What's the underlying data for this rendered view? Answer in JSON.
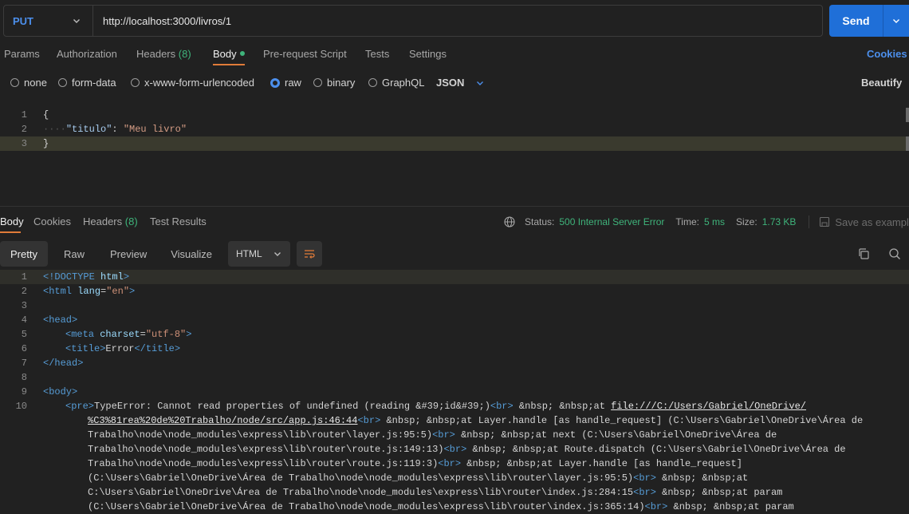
{
  "request": {
    "method": "PUT",
    "url": "http://localhost:3000/livros/1",
    "send_label": "Send"
  },
  "req_tabs": {
    "params": "Params",
    "authorization": "Authorization",
    "headers": "Headers",
    "headers_count": "(8)",
    "body": "Body",
    "prerequest": "Pre-request Script",
    "tests": "Tests",
    "settings": "Settings",
    "cookies": "Cookies"
  },
  "body_types": {
    "none": "none",
    "form_data": "form-data",
    "urlencoded": "x-www-form-urlencoded",
    "raw": "raw",
    "binary": "binary",
    "graphql": "GraphQL",
    "format": "JSON",
    "beautify": "Beautify"
  },
  "editor": {
    "lines": [
      "1",
      "2",
      "3"
    ],
    "open_brace": "{",
    "key": "\"titulo\"",
    "colon": ": ",
    "value": "\"Meu livro\"",
    "close_brace": "}"
  },
  "response": {
    "tabs": {
      "body": "Body",
      "cookies": "Cookies",
      "headers": "Headers",
      "headers_count": "(8)",
      "test_results": "Test Results"
    },
    "status_label": "Status:",
    "status_value": "500 Internal Server Error",
    "time_label": "Time:",
    "time_value": "5 ms",
    "size_label": "Size:",
    "size_value": "1.73 KB",
    "save_example": "Save as example",
    "views": {
      "pretty": "Pretty",
      "raw": "Raw",
      "preview": "Preview",
      "visualize": "Visualize"
    },
    "language": "HTML",
    "line_numbers": [
      "1",
      "2",
      "3",
      "4",
      "5",
      "6",
      "7",
      "8",
      "9",
      "10"
    ],
    "code": {
      "l1_tag": "<!DOCTYPE",
      "l1_attr": "html",
      "l1_end": ">",
      "l2_open": "<html",
      "l2_attr": "lang",
      "l2_eq": "=",
      "l2_val": "\"en\"",
      "l2_end": ">",
      "l4": "<head>",
      "l5_open": "<meta",
      "l5_attr": "charset",
      "l5_eq": "=",
      "l5_val": "\"utf-8\"",
      "l5_end": ">",
      "l6_open": "<title>",
      "l6_text": "Error",
      "l6_close": "</title>",
      "l7": "</head>",
      "l9": "<body>",
      "l10_pre": "<pre>",
      "l10_text": "TypeError: Cannot read properties of undefined (reading &#39;id&#39;)",
      "br": "<br>",
      "l10_nbsp": " &nbsp; &nbsp;at ",
      "l10_link1": "file:///C:/Users/Gabriel/OneDrive/",
      "w1_link": "%C3%81rea%20de%20Trabalho/node/src/app.js:46:44",
      "w1_text": " &nbsp; &nbsp;at Layer.handle [as handle_request] (C:\\Users\\Gabriel\\OneDrive\\Área de",
      "w2_text": "Trabalho\\node\\node_modules\\express\\lib\\router\\layer.js:95:5)",
      "w2_text2": " &nbsp; &nbsp;at next (C:\\Users\\Gabriel\\OneDrive\\Área de",
      "w3_text": "Trabalho\\node\\node_modules\\express\\lib\\router\\route.js:149:13)",
      "w3_text2": " &nbsp; &nbsp;at Route.dispatch (C:\\Users\\Gabriel\\OneDrive\\Área de",
      "w4_text": "Trabalho\\node\\node_modules\\express\\lib\\router\\route.js:119:3)",
      "w4_text2": " &nbsp; &nbsp;at Layer.handle [as handle_request]",
      "w5_text": "(C:\\Users\\Gabriel\\OneDrive\\Área de Trabalho\\node\\node_modules\\express\\lib\\router\\layer.js:95:5)",
      "w5_text2": " &nbsp; &nbsp;at",
      "w6_text": "C:\\Users\\Gabriel\\OneDrive\\Área de Trabalho\\node\\node_modules\\express\\lib\\router\\index.js:284:15",
      "w6_text2": " &nbsp; &nbsp;at param",
      "w7_text": "(C:\\Users\\Gabriel\\OneDrive\\Área de Trabalho\\node\\node_modules\\express\\lib\\router\\index.js:365:14)",
      "w7_text2": " &nbsp; &nbsp;at param"
    }
  },
  "colors": {
    "accent": "#1f6fd8",
    "link_blue": "#4c8fec",
    "status_green": "#3fb47b",
    "background": "#212121"
  },
  "icons": [
    "chevron-down-icon",
    "globe-icon",
    "save-icon",
    "more-icon",
    "wrap-lines-icon",
    "copy-icon",
    "search-icon"
  ]
}
